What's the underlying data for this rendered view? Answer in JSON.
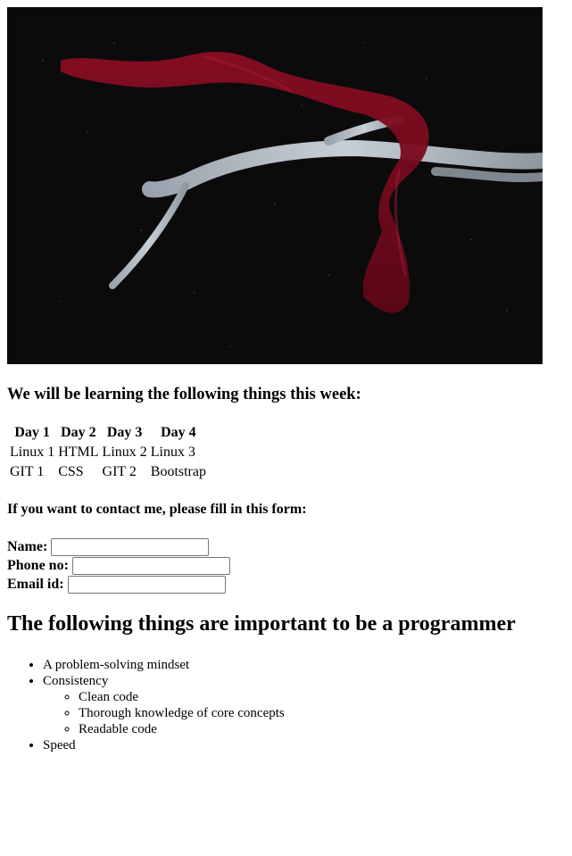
{
  "hero": {
    "icon": "antler-red-cloth-image"
  },
  "week_heading": "We will be learning the following things this week:",
  "schedule": {
    "headers": [
      "Day 1",
      "Day 2",
      "Day 3",
      "Day 4"
    ],
    "rows": [
      [
        "Linux 1",
        "HTML",
        "Linux 2",
        "Linux 3"
      ],
      [
        "GIT 1",
        "CSS",
        "GIT 2",
        "Bootstrap"
      ]
    ]
  },
  "contact_heading": "If you want to contact me, please fill in this form:",
  "form": {
    "name_label": "Name:",
    "phone_label": "Phone no:",
    "email_label": "Email id:"
  },
  "important_heading": "The following things are important to be a programmer",
  "list": {
    "item1": "A problem-solving mindset",
    "item2": "Consistency",
    "sub": [
      "Clean code",
      "Thorough knowledge of core concepts",
      "Readable code"
    ],
    "item3": "Speed"
  }
}
